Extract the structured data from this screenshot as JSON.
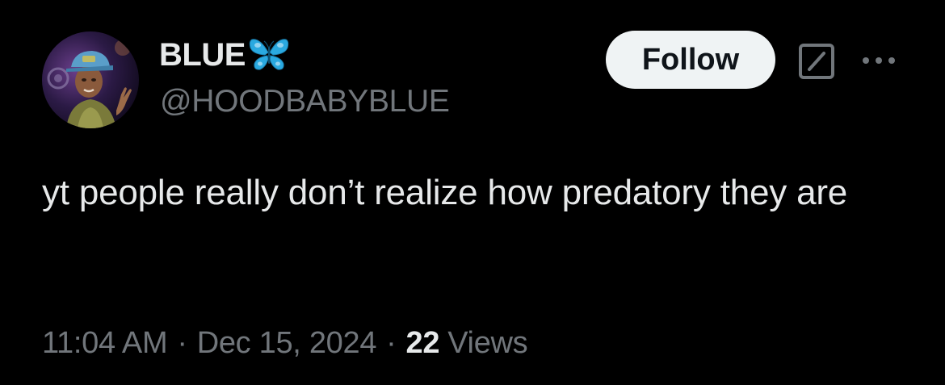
{
  "author": {
    "display_name": "BLUE",
    "handle": "@HOODBABYBLUE",
    "verified_emoji_icon": "butterfly-icon",
    "avatar_icon": "profile-photo"
  },
  "actions": {
    "follow_label": "Follow",
    "grok_icon": "grok-icon",
    "more_icon": "more-options-icon"
  },
  "tweet": {
    "text": "yt people really don’t realize how predatory they are"
  },
  "meta": {
    "time": "11:04 AM",
    "date": "Dec 15, 2024",
    "separator": "·",
    "views_count": "22",
    "views_label": "Views"
  },
  "colors": {
    "background": "#000000",
    "primary_text": "#e7e9ea",
    "secondary_text": "#71767b",
    "follow_bg": "#eff3f4",
    "follow_text": "#0f1419",
    "butterfly": "#2aa9e0"
  }
}
